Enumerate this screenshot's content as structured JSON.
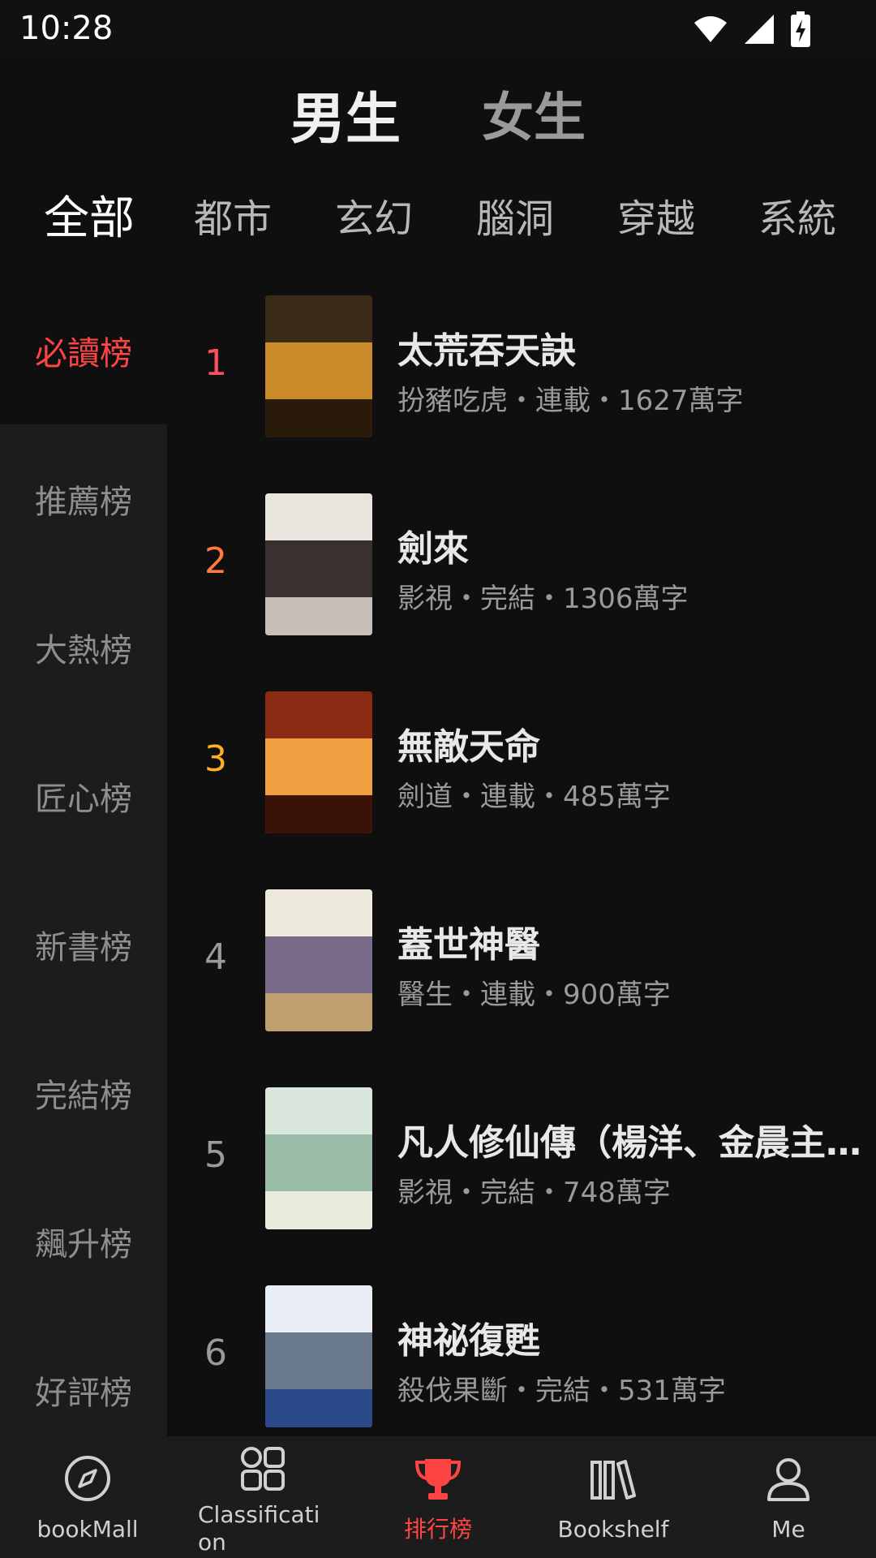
{
  "status_bar": {
    "time": "10:28"
  },
  "gender_tabs": [
    {
      "label": "男生",
      "active": true
    },
    {
      "label": "女生",
      "active": false
    }
  ],
  "category_tabs": [
    {
      "label": "全部",
      "active": true
    },
    {
      "label": "都市"
    },
    {
      "label": "玄幻"
    },
    {
      "label": "腦洞"
    },
    {
      "label": "穿越"
    },
    {
      "label": "系統"
    }
  ],
  "side_nav": [
    {
      "label": "必讀榜",
      "active": true
    },
    {
      "label": "推薦榜"
    },
    {
      "label": "大熱榜"
    },
    {
      "label": "匠心榜"
    },
    {
      "label": "新書榜"
    },
    {
      "label": "完結榜"
    },
    {
      "label": "飆升榜"
    },
    {
      "label": "好評榜"
    }
  ],
  "books": [
    {
      "rank": "1",
      "title": "太荒吞天訣",
      "meta": "扮豬吃虎・連載・1627萬字",
      "rank_color": "#ff4d5e",
      "cover": [
        "#3a2a18",
        "#c98a2a",
        "#2a1a0a"
      ]
    },
    {
      "rank": "2",
      "title": "劍來",
      "meta": "影視・完結・1306萬字",
      "rank_color": "#ff7a3d",
      "cover": [
        "#e8e4de",
        "#3a3030",
        "#c8c0b8"
      ]
    },
    {
      "rank": "3",
      "title": "無敵天命",
      "meta": "劍道・連載・485萬字",
      "rank_color": "#ffb020",
      "cover": [
        "#8a2a12",
        "#f0a040",
        "#3a1208"
      ]
    },
    {
      "rank": "4",
      "title": "蓋世神醫",
      "meta": "醫生・連載・900萬字",
      "rank_color": "#9a9a9a",
      "cover": [
        "#ece8dc",
        "#7a6a8a",
        "#c0a070"
      ]
    },
    {
      "rank": "5",
      "title": "凡人修仙傳（楊洋、金晨主演...",
      "meta": "影視・完結・748萬字",
      "rank_color": "#9a9a9a",
      "cover": [
        "#d8e6dc",
        "#9abca8",
        "#e8ecdc"
      ]
    },
    {
      "rank": "6",
      "title": "神祕復甦",
      "meta": "殺伐果斷・完結・531萬字",
      "rank_color": "#9a9a9a",
      "cover": [
        "#e8eef4",
        "#6a7a8c",
        "#2a4a8a"
      ]
    }
  ],
  "bottom_nav": [
    {
      "label": "bookMall",
      "icon": "compass-icon",
      "active": false
    },
    {
      "label": "Classificati on",
      "icon": "grid-icon",
      "active": false
    },
    {
      "label": "排行榜",
      "icon": "trophy-icon",
      "active": true
    },
    {
      "label": "Bookshelf",
      "icon": "bookshelf-icon",
      "active": false
    },
    {
      "label": "Me",
      "icon": "person-icon",
      "active": false
    }
  ],
  "colors": {
    "accent": "#ff4444"
  }
}
